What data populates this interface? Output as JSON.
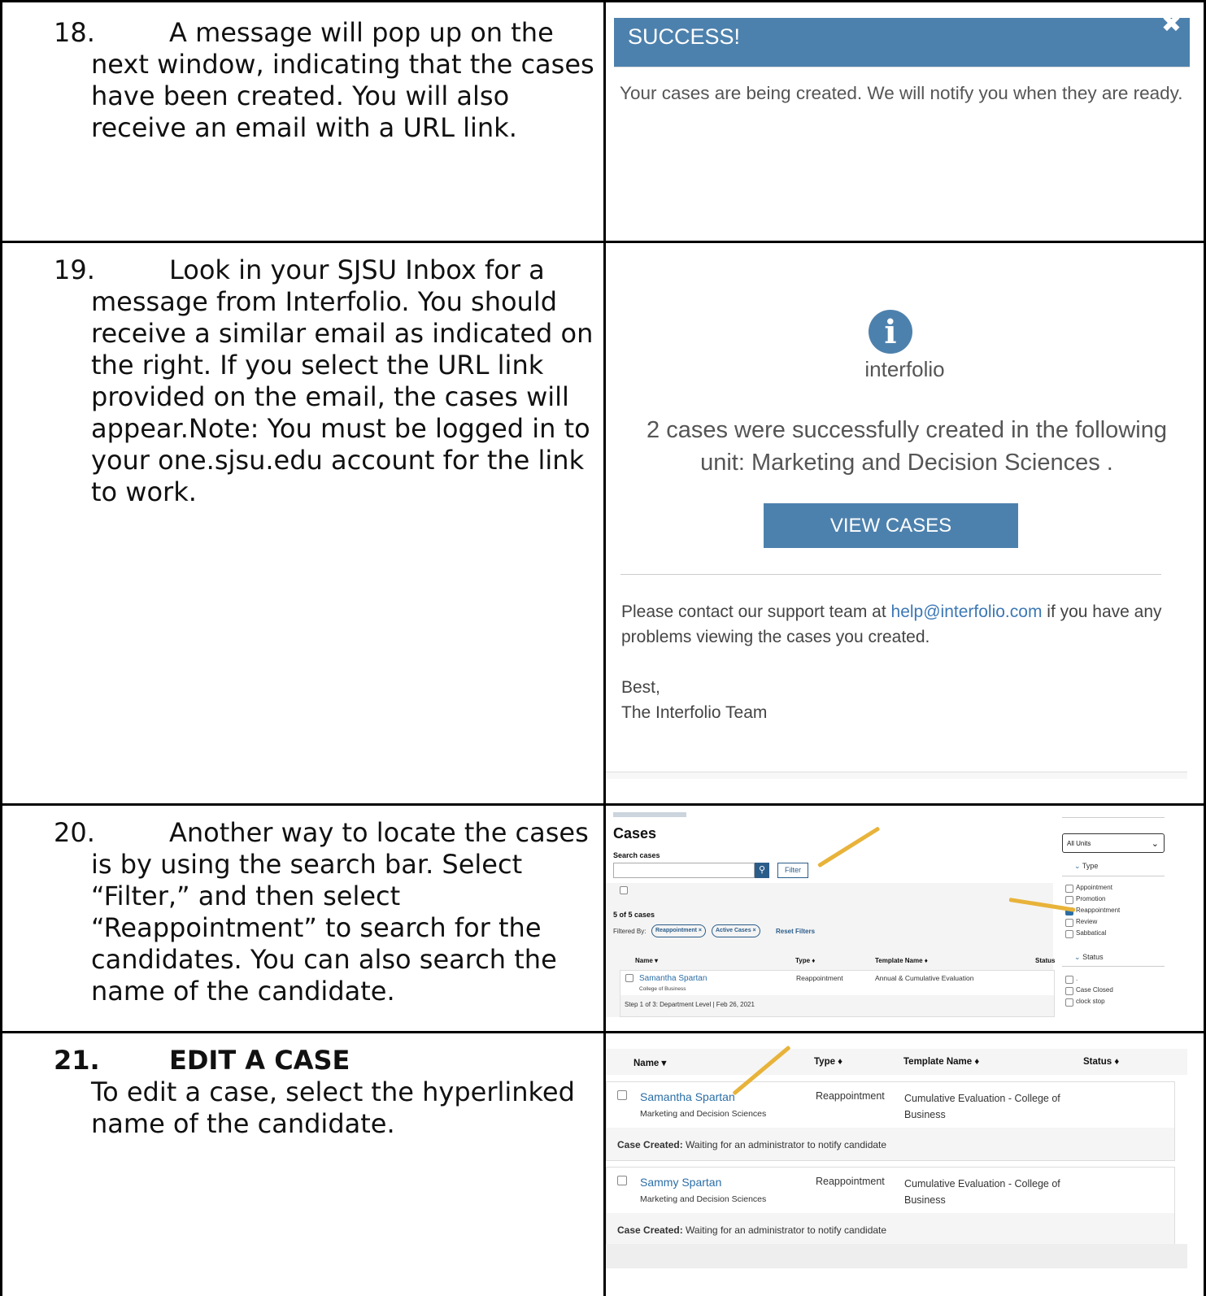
{
  "rows": [
    {
      "number": "18.",
      "first_line": "A message will pop up on the",
      "body": "next window, indicating that the cases have been created. You will also receive an email with a URL link."
    },
    {
      "number": "19.",
      "first_line": "Look in your SJSU Inbox for a",
      "body": "message from Interfolio. You should receive a similar email as indicated on the right. If you select the URL link provided on the email, the cases will appear.Note: You must be logged in to your one.sjsu.edu account for the link to work."
    },
    {
      "number": "20.",
      "first_line": "Another way to locate the cases",
      "body": "is by using the search bar. Select “Filter,” and then select “Reappointment” to search for the candidates. You can also search the name of the candidate."
    },
    {
      "number": "21.",
      "first_line": "EDIT A CASE",
      "body": "To edit a case, select the hyperlinked name of the candidate."
    }
  ],
  "success_dialog": {
    "title": "SUCCESS!",
    "close": "✖",
    "message": "Your cases are being created. We will notify you when they are ready."
  },
  "email": {
    "logo_letter": "i",
    "logo_text": "interfolio",
    "headline": "2 cases were successfully created in the following unit: Marketing and Decision Sciences .",
    "button": "VIEW CASES",
    "body_prefix": "Please contact our support team at ",
    "support_email": "help@interfolio.com",
    "body_suffix": " if you have any problems viewing the cases you created.",
    "sign_1": "Best,",
    "sign_2": "The Interfolio Team"
  },
  "cases_search": {
    "title": "Cases",
    "search_label": "Search cases",
    "search_icon": "search-icon",
    "filter": "Filter",
    "count": "5 of 5 cases",
    "filtered_by": "Filtered By:",
    "pill_1": "Reappointment ×",
    "pill_2": "Active Cases ×",
    "reset": "Reset Filters",
    "col_name": "Name ▾",
    "col_type": "Type ♦",
    "col_template": "Template Name ♦",
    "col_status": "Status",
    "row_name": "Samantha Spartan",
    "row_unit": "College of Business",
    "row_type": "Reappointment",
    "row_template": "Annual & Cumulative Evaluation",
    "row_step": "Step 1 of 3: Department Level | Feb 26, 2021",
    "unit_select": "All Units",
    "type_heading": "Type",
    "type_options": [
      "Appointment",
      "Promotion",
      "Reappointment",
      "Review",
      "Sabbatical"
    ],
    "status_heading": "Status",
    "status_options": [
      ".",
      "Case Closed",
      "clock stop"
    ]
  },
  "case_list": {
    "col_name": "Name ▾",
    "col_type": "Type ♦",
    "col_template": "Template Name ♦",
    "col_status": "Status ♦",
    "cases": [
      {
        "name": "Samantha Spartan",
        "unit": "Marketing and Decision Sciences",
        "type": "Reappointment",
        "template": "Cumulative Evaluation - College of Business",
        "status_label": "Case Created:",
        "status_text": " Waiting for an administrator to notify candidate"
      },
      {
        "name": "Sammy Spartan",
        "unit": "Marketing and Decision Sciences",
        "type": "Reappointment",
        "template": "Cumulative Evaluation - College of Business",
        "status_label": "Case Created:",
        "status_text": " Waiting for an administrator to notify candidate"
      }
    ]
  },
  "colors": {
    "brand": "#4d81ad",
    "link": "#2b6ea6",
    "arrow": "#e8b33a"
  }
}
